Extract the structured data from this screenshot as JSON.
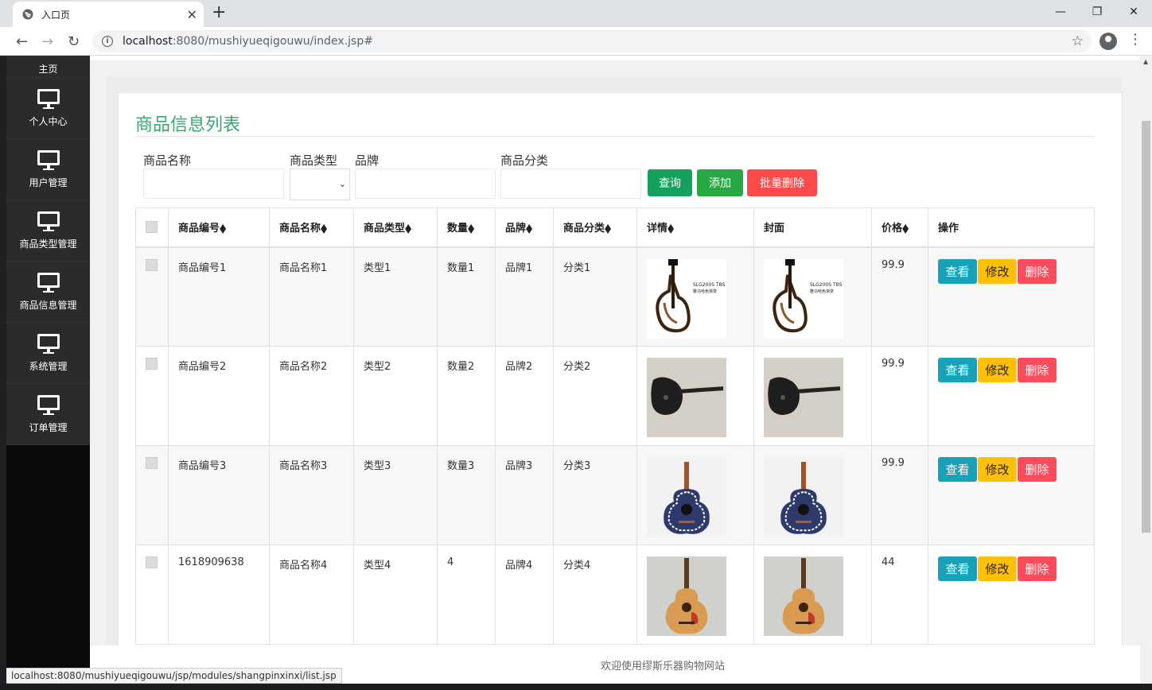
{
  "browser": {
    "tab_title": "入口页",
    "url_host": "localhost",
    "url_path": ":8080/mushiyueqigouwu/index.jsp#",
    "status_url": "localhost:8080/mushiyueqigouwu/jsp/modules/shangpinxinxi/list.jsp"
  },
  "sidebar": {
    "items": [
      {
        "label": "主页"
      },
      {
        "label": "个人中心"
      },
      {
        "label": "用户管理"
      },
      {
        "label": "商品类型管理"
      },
      {
        "label": "商品信息管理"
      },
      {
        "label": "系统管理"
      },
      {
        "label": "订单管理"
      }
    ]
  },
  "page": {
    "title": "商品信息列表",
    "filters": {
      "name_label": "商品名称",
      "type_label": "商品类型",
      "brand_label": "品牌",
      "category_label": "商品分类"
    },
    "buttons": {
      "search": "查询",
      "add": "添加",
      "batch_delete": "批量删除"
    },
    "columns": [
      "商品编号",
      "商品名称",
      "商品类型",
      "数量",
      "品牌",
      "商品分类",
      "详情",
      "封面",
      "价格",
      "操作"
    ],
    "rows": [
      {
        "code": "商品编号1",
        "name": "商品名称1",
        "type": "类型1",
        "qty": "数量1",
        "brand": "品牌1",
        "category": "分类1",
        "price": "99.9",
        "image": "silent-guitar"
      },
      {
        "code": "商品编号2",
        "name": "商品名称2",
        "type": "类型2",
        "qty": "数量2",
        "brand": "品牌2",
        "category": "分类2",
        "price": "99.9",
        "image": "electric-guitar"
      },
      {
        "code": "商品编号3",
        "name": "商品名称3",
        "type": "类型3",
        "qty": "数量3",
        "brand": "品牌3",
        "category": "分类3",
        "price": "99.9",
        "image": "patterned-guitar"
      },
      {
        "code": "1618909638",
        "name": "商品名称4",
        "type": "类型4",
        "qty": "4",
        "brand": "品牌4",
        "category": "分类4",
        "price": "44",
        "image": "acoustic-guitar"
      }
    ],
    "row_actions": {
      "view": "查看",
      "edit": "修改",
      "delete": "删除"
    },
    "thumb_text": "SLG200S TBS\n雅马哈色渐变",
    "footer": "欢迎使用缪斯乐器购物网站"
  },
  "colors": {
    "title_green": "#3aa56f",
    "search_btn": "#17a05d",
    "add_btn": "#28a745",
    "batch_delete_btn": "#fc4b4b",
    "view_btn": "#17a2b8",
    "edit_btn": "#ffc107",
    "delete_btn": "#fc4b5a"
  }
}
